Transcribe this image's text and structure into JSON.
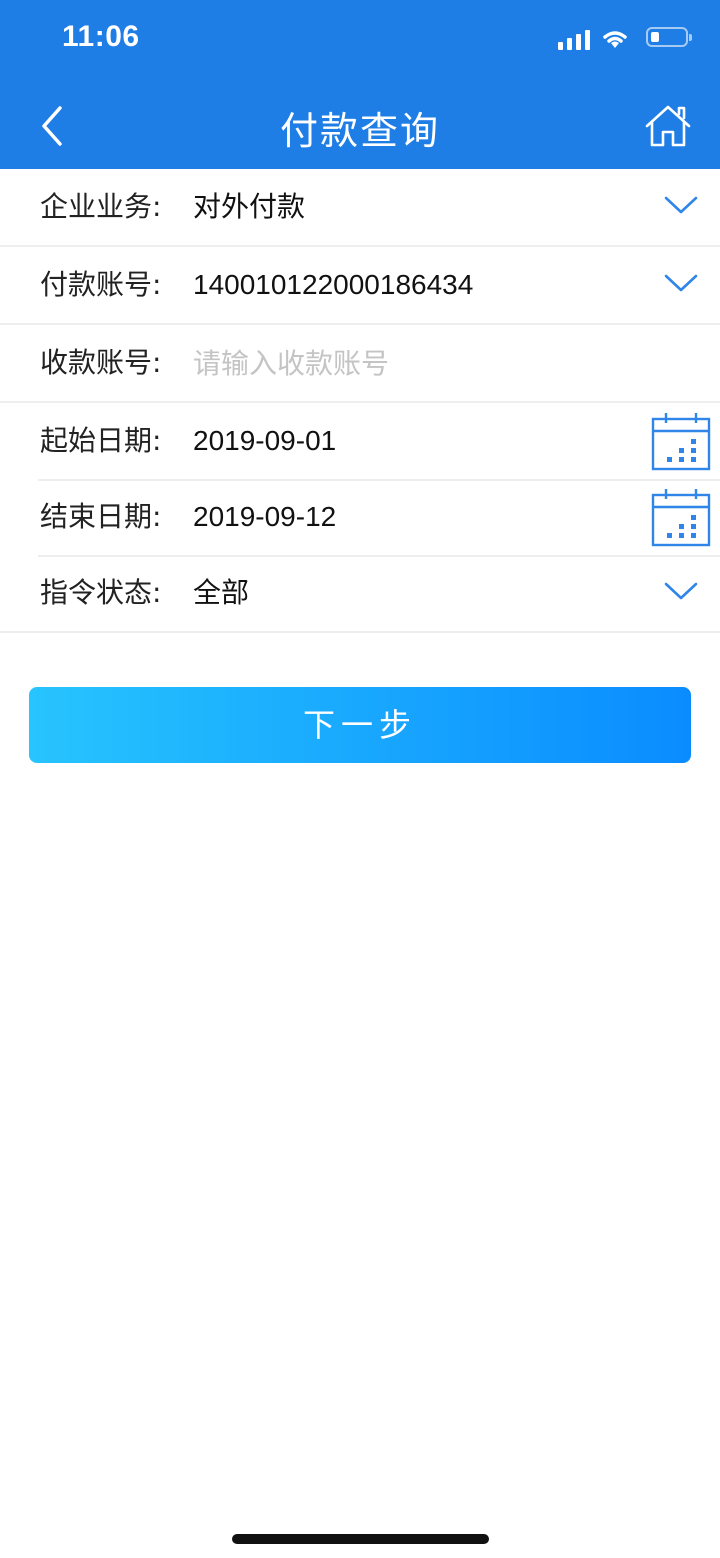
{
  "status_bar": {
    "time": "11:06",
    "battery_level": 0.2
  },
  "header": {
    "title": "付款查询",
    "back_icon": "chevron-left-icon",
    "home_icon": "home-icon",
    "background": "#1f7de6"
  },
  "form": {
    "business": {
      "label": "企业业务:",
      "value": "对外付款"
    },
    "payer_account": {
      "label": "付款账号:",
      "value": "140010122000186434"
    },
    "payee_account": {
      "label": "收款账号:",
      "value": "",
      "placeholder": "请输入收款账号"
    },
    "start_date": {
      "label": "起始日期:",
      "value": "2019-09-01"
    },
    "end_date": {
      "label": "结束日期:",
      "value": "2019-09-12"
    },
    "status": {
      "label": "指令状态:",
      "value": "全部"
    }
  },
  "next_button": {
    "label": "下一步",
    "gradient_start": "#27c4fe",
    "gradient_end": "#0a8cff"
  },
  "accent_color": "#2f86e8"
}
